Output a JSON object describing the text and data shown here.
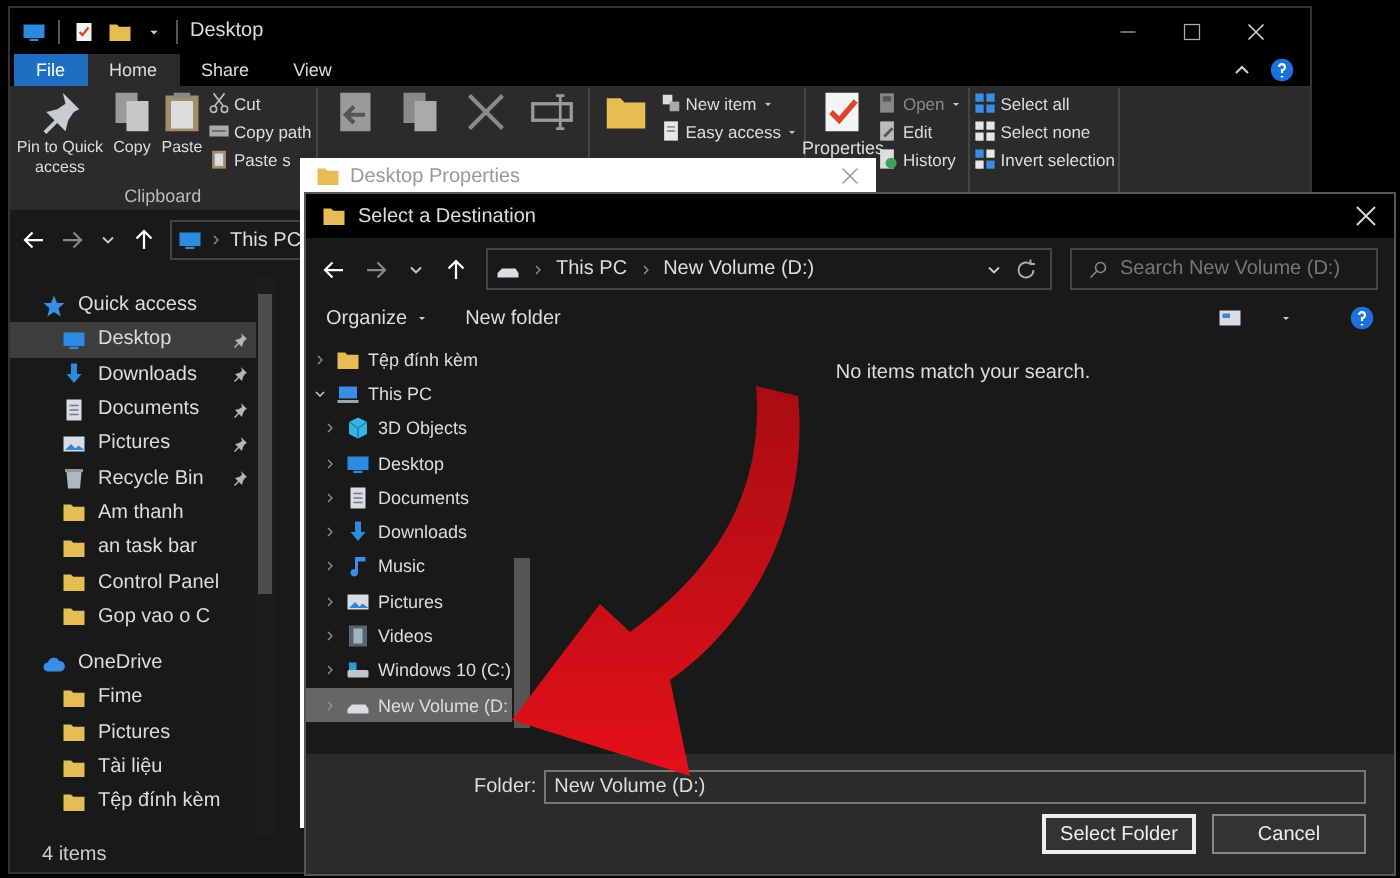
{
  "explorer": {
    "title": "Desktop",
    "tabs": [
      {
        "label": "File",
        "kind": "file",
        "selected": false
      },
      {
        "label": "Home",
        "kind": "tab",
        "selected": true
      },
      {
        "label": "Share",
        "kind": "tab",
        "selected": false
      },
      {
        "label": "View",
        "kind": "tab",
        "selected": false
      }
    ],
    "ribbon": [
      {
        "label": "Clipboard",
        "big": [
          {
            "label": "Pin to Quick access",
            "kind": "pin-big"
          },
          {
            "label": "Copy",
            "kind": "copy"
          },
          {
            "label": "Paste",
            "kind": "paste"
          }
        ],
        "small": [
          {
            "label": "Cut",
            "kind": "cut",
            "dropdown": false,
            "disabled": false
          },
          {
            "label": "Copy path",
            "kind": "copy-path",
            "dropdown": false,
            "disabled": false
          },
          {
            "label": "Paste s",
            "kind": "paste-shortcut",
            "dropdown": false,
            "disabled": false
          }
        ]
      },
      {
        "big": [
          {
            "kind": "move"
          },
          {
            "kind": "copy-to"
          },
          {
            "kind": "delete"
          },
          {
            "kind": "rename"
          }
        ]
      },
      {
        "big": [
          {
            "kind": "new-folder"
          }
        ],
        "small": [
          {
            "label": "New item",
            "kind": "new-item",
            "dropdown": true,
            "disabled": false
          },
          {
            "label": "Easy access",
            "kind": "easy-access",
            "dropdown": true,
            "disabled": false
          }
        ]
      },
      {
        "big": [
          {
            "label": "Properties",
            "kind": "properties"
          }
        ],
        "small": [
          {
            "label": "Open",
            "kind": "open",
            "dropdown": true,
            "disabled": true
          },
          {
            "label": "Edit",
            "kind": "edit",
            "dropdown": false,
            "disabled": false
          },
          {
            "label": "History",
            "kind": "history",
            "dropdown": false,
            "disabled": false
          }
        ]
      },
      {
        "small": [
          {
            "label": "Select all",
            "kind": "select-all",
            "dropdown": false,
            "disabled": false
          },
          {
            "label": "Select none",
            "kind": "select-none",
            "dropdown": false,
            "disabled": false
          },
          {
            "label": "Invert selection",
            "kind": "invert",
            "dropdown": false,
            "disabled": false
          }
        ]
      }
    ],
    "address": [
      "This PC"
    ],
    "nav": [
      {
        "label": "Quick access",
        "kind": "star",
        "children": [
          {
            "label": "Desktop",
            "kind": "desktop",
            "pinned": true,
            "selected": true
          },
          {
            "label": "Downloads",
            "kind": "download",
            "pinned": true,
            "selected": false
          },
          {
            "label": "Documents",
            "kind": "documents",
            "pinned": true,
            "selected": false
          },
          {
            "label": "Pictures",
            "kind": "pictures",
            "pinned": true,
            "selected": false
          },
          {
            "label": "Recycle Bin",
            "kind": "recycle",
            "pinned": true,
            "selected": false
          },
          {
            "label": "Am thanh",
            "kind": "folder",
            "pinned": false,
            "selected": false
          },
          {
            "label": "an task bar",
            "kind": "folder",
            "pinned": false,
            "selected": false
          },
          {
            "label": "Control Panel",
            "kind": "folder",
            "pinned": false,
            "selected": false
          },
          {
            "label": "Gop vao o C",
            "kind": "folder",
            "pinned": false,
            "selected": false
          }
        ]
      },
      {
        "label": "OneDrive",
        "kind": "cloud",
        "children": [
          {
            "label": "Fime",
            "kind": "folder",
            "pinned": false,
            "selected": false
          },
          {
            "label": "Pictures",
            "kind": "folder",
            "pinned": false,
            "selected": false
          },
          {
            "label": "Tài liệu",
            "kind": "folder",
            "pinned": false,
            "selected": false
          },
          {
            "label": "Tệp đính kèm",
            "kind": "folder",
            "pinned": false,
            "selected": false
          }
        ]
      }
    ],
    "status": "4 items"
  },
  "properties_window": {
    "title": "Desktop Properties"
  },
  "dialog": {
    "title": "Select a Destination",
    "address": [
      "This PC",
      "New Volume (D:)"
    ],
    "search": {
      "placeholder": "Search New Volume (D:)"
    },
    "toolbar": [
      {
        "label": "Organize",
        "dropdown": true
      },
      {
        "label": "New folder",
        "dropdown": false
      }
    ],
    "tree": [
      {
        "label": "Tệp đính kèm",
        "kind": "folder",
        "expanded": false,
        "selected": false
      },
      {
        "label": "This PC",
        "kind": "computer",
        "expanded": true,
        "selected": false,
        "children": [
          {
            "label": "3D Objects",
            "kind": "cube",
            "expanded": false,
            "selected": false
          },
          {
            "label": "Desktop",
            "kind": "desktop",
            "expanded": false,
            "selected": false
          },
          {
            "label": "Documents",
            "kind": "documents",
            "expanded": false,
            "selected": false
          },
          {
            "label": "Downloads",
            "kind": "download",
            "expanded": false,
            "selected": false
          },
          {
            "label": "Music",
            "kind": "music",
            "expanded": false,
            "selected": false
          },
          {
            "label": "Pictures",
            "kind": "pictures",
            "expanded": false,
            "selected": false
          },
          {
            "label": "Videos",
            "kind": "videos",
            "expanded": false,
            "selected": false
          },
          {
            "label": "Windows 10 (C:)",
            "kind": "drive-c",
            "expanded": false,
            "selected": false
          },
          {
            "label": "New Volume (D:",
            "kind": "drive-d",
            "expanded": false,
            "selected": true
          }
        ]
      }
    ],
    "empty_message": "No items match your search.",
    "folder": {
      "label": "Folder:",
      "value": "New Volume (D:)"
    },
    "buttons": [
      {
        "label": "Select Folder",
        "focused": true
      },
      {
        "label": "Cancel",
        "focused": false
      }
    ]
  }
}
